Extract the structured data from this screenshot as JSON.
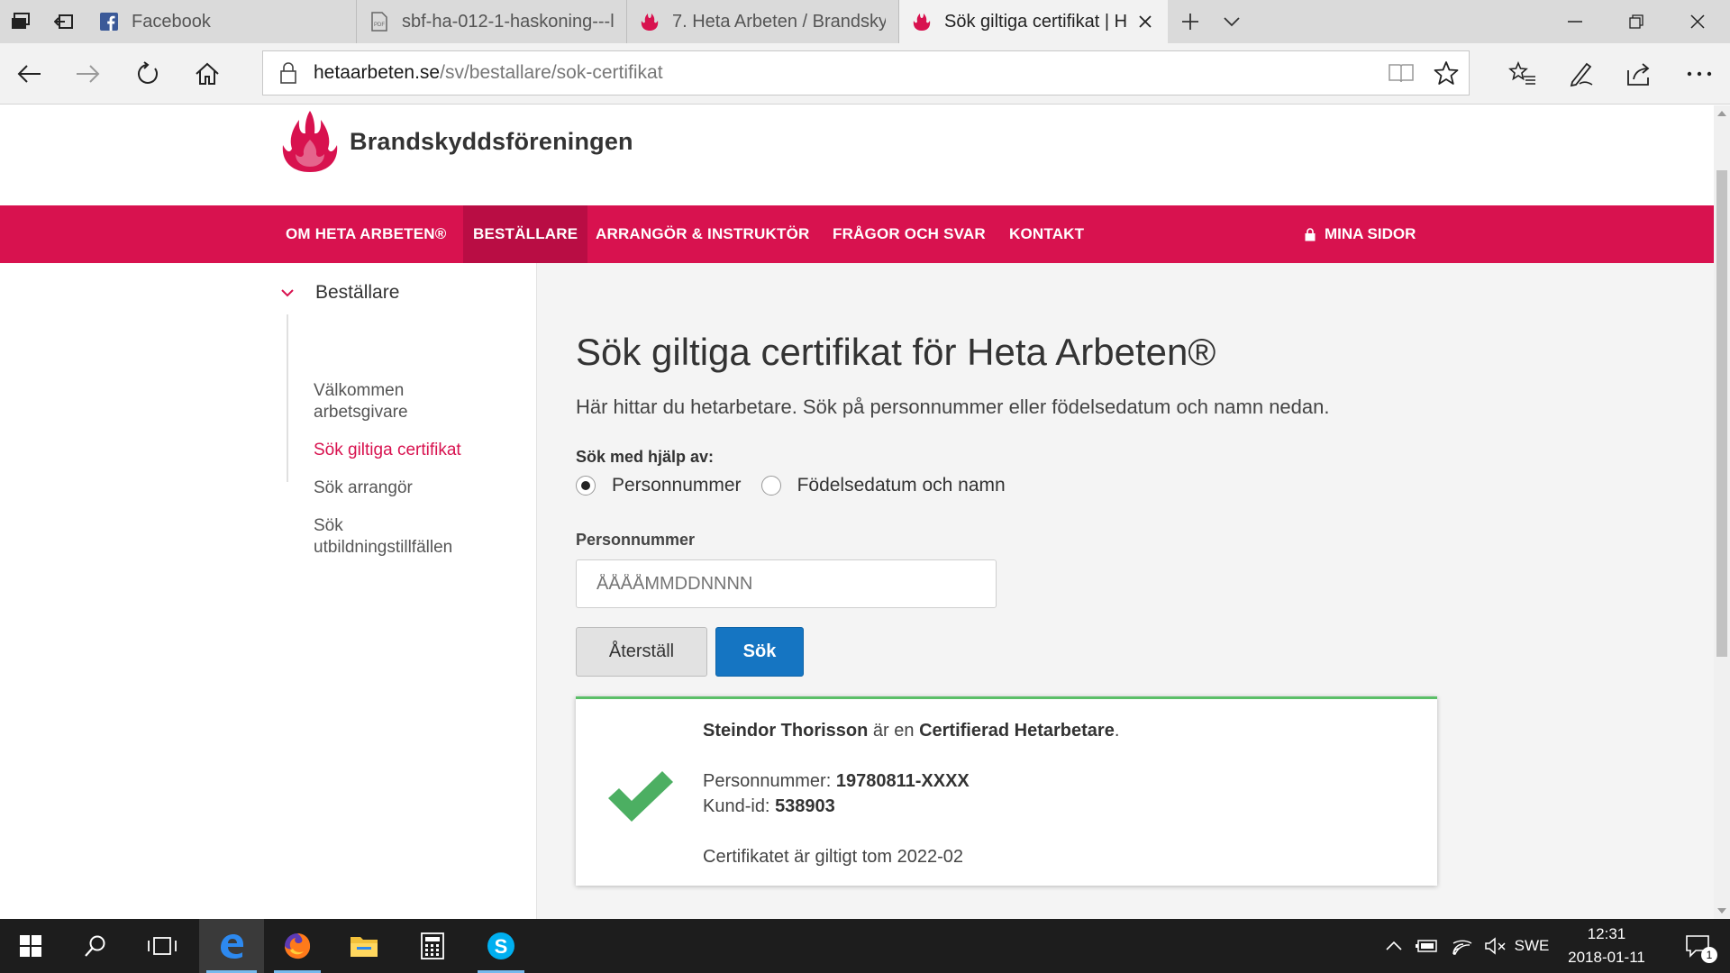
{
  "browser": {
    "tabs": [
      {
        "title": "Facebook",
        "icon": "facebook-icon",
        "active": false
      },
      {
        "title": "sbf-ha-012-1-haskoning---l",
        "icon": "pdf-icon",
        "active": false
      },
      {
        "title": "7. Heta Arbeten / Brandskyd",
        "icon": "flame-favicon",
        "active": false
      },
      {
        "title": "Sök giltiga certifikat | H",
        "icon": "flame-favicon",
        "active": true
      }
    ],
    "url": {
      "host": "hetaarbeten.se",
      "path": "/sv/bestallare/sok-certifikat"
    }
  },
  "site": {
    "brand": "Brandskyddsföreningen",
    "nav": [
      {
        "label": "OM HETA ARBETEN®",
        "active": false
      },
      {
        "label": "BESTÄLLARE",
        "active": true
      },
      {
        "label": "ARRANGÖR & INSTRUKTÖR",
        "active": false
      },
      {
        "label": "FRÅGOR OCH SVAR",
        "active": false
      },
      {
        "label": "KONTAKT",
        "active": false
      }
    ],
    "mina_sidor": "MINA SIDOR"
  },
  "sidebar": {
    "heading": "Beställare",
    "items": [
      {
        "label": "Välkommen arbetsgivare",
        "active": false
      },
      {
        "label": "Sök giltiga certifikat",
        "active": true
      },
      {
        "label": "Sök arrangör",
        "active": false
      },
      {
        "label": "Sök utbildningstillfällen",
        "active": false
      }
    ]
  },
  "main": {
    "title": "Sök giltiga certifikat för Heta Arbeten®",
    "intro": "Här hittar du hetarbetare. Sök på personnummer eller födelsedatum och namn nedan.",
    "search_by_label": "Sök med hjälp av:",
    "radio_options": [
      {
        "label": "Personnummer",
        "checked": true
      },
      {
        "label": "Födelsedatum och namn",
        "checked": false
      }
    ],
    "field_label": "Personnummer",
    "field_placeholder": "ÅÅÅÅMMDDNNNN",
    "field_value": "",
    "reset_label": "Återställ",
    "search_label": "Sök"
  },
  "result": {
    "name": "Steindor Thorisson",
    "is_text": "är en",
    "status": "Certifierad Hetarbetare",
    "status_suffix": ".",
    "pnr_label": "Personnummer:",
    "pnr_value": "19780811-XXXX",
    "kundid_label": "Kund-id:",
    "kundid_value": "538903",
    "validity": "Certifikatet är giltigt tom 2022-02"
  },
  "taskbar": {
    "apps": [
      "start-icon",
      "search-icon",
      "task-view-icon",
      "edge-icon",
      "firefox-icon",
      "file-explorer-icon",
      "calculator-icon",
      "skype-icon"
    ],
    "language": "SWE",
    "time": "12:31",
    "date": "2018-01-11",
    "notification_count": "1"
  },
  "colors": {
    "brand": "#d8124f",
    "brand_dark": "#b90d44",
    "primary_button": "#1575c2",
    "success": "#5bbf68"
  }
}
